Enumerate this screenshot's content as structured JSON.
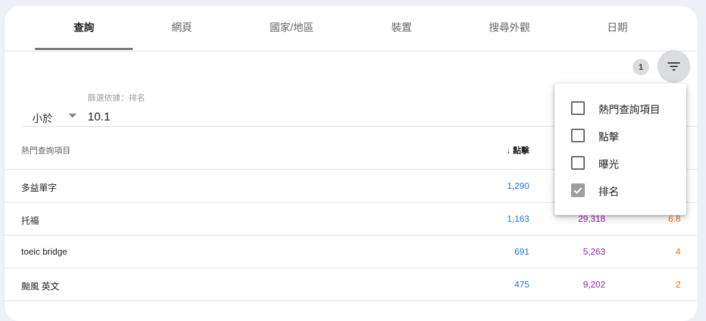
{
  "tabs": [
    "查詢",
    "網頁",
    "國家/地區",
    "裝置",
    "搜尋外觀",
    "日期"
  ],
  "filter_count": "1",
  "filter": {
    "caption": "篩選依據：排名",
    "operator": "小於",
    "value": "10.1"
  },
  "table": {
    "col_query": "熱門查詢項目",
    "col_clicks": "點擊",
    "rows": [
      {
        "query": "多益單字",
        "clicks": "1,290",
        "impressions": "",
        "position": ""
      },
      {
        "query": "托福",
        "clicks": "1,163",
        "impressions": "29,318",
        "position": "6.8"
      },
      {
        "query": "toeic bridge",
        "clicks": "691",
        "impressions": "5,263",
        "position": "4"
      },
      {
        "query": "颱風 英文",
        "clicks": "475",
        "impressions": "9,202",
        "position": "2"
      }
    ]
  },
  "menu": {
    "items": [
      {
        "label": "熱門查詢項目",
        "checked": false
      },
      {
        "label": "點擊",
        "checked": false
      },
      {
        "label": "曝光",
        "checked": false
      },
      {
        "label": "排名",
        "checked": true
      }
    ]
  }
}
